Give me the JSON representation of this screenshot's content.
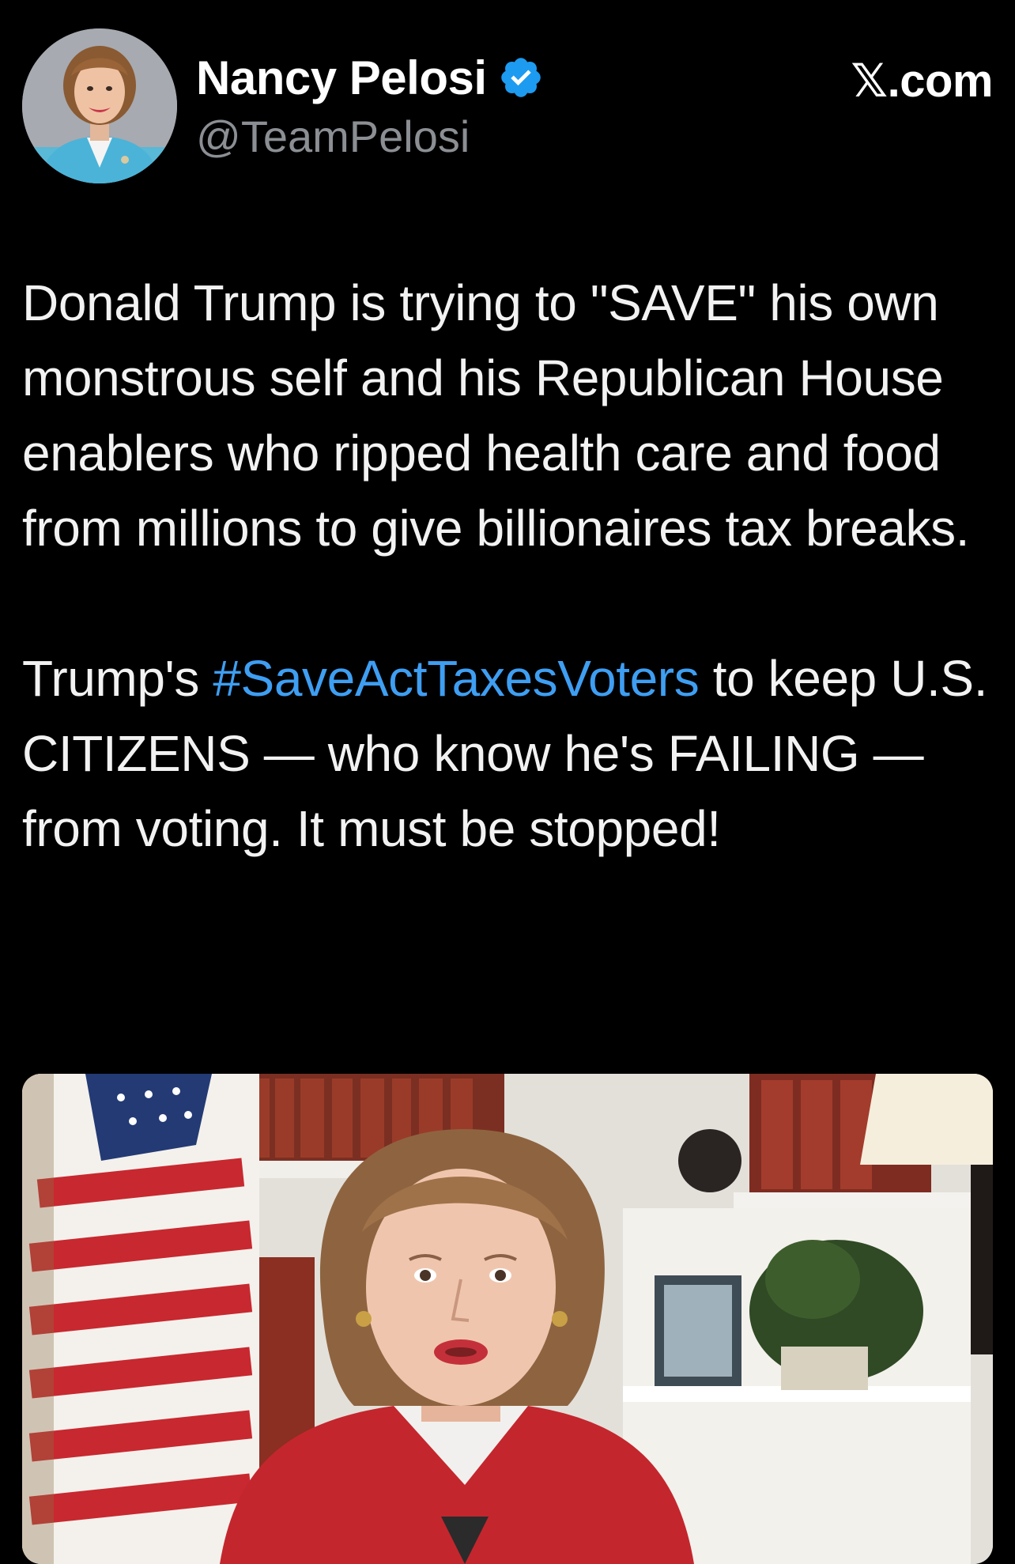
{
  "tweet": {
    "author": {
      "display_name": "Nancy Pelosi",
      "handle": "@TeamPelosi",
      "verified": true,
      "verified_icon": "verified-badge-icon"
    },
    "site_label": "𝕏.com",
    "text": {
      "paragraph1": "Donald Trump is trying to \"SAVE\" his own monstrous self and his Republican House enablers who ripped health care and food from millions to give billionaires tax breaks.",
      "paragraph2_before": "Trump's ",
      "hashtag": "#SaveActTaxesVoters",
      "paragraph2_after": " to keep U.S. CITIZENS — who know he's FAILING — from voting. It must be stopped!"
    },
    "media": {
      "type": "video-still"
    }
  },
  "colors": {
    "background": "#000000",
    "text": "#f2f2f2",
    "secondary_text": "#8b8f94",
    "link": "#3e9ef2",
    "verified": "#1d9bf0"
  }
}
